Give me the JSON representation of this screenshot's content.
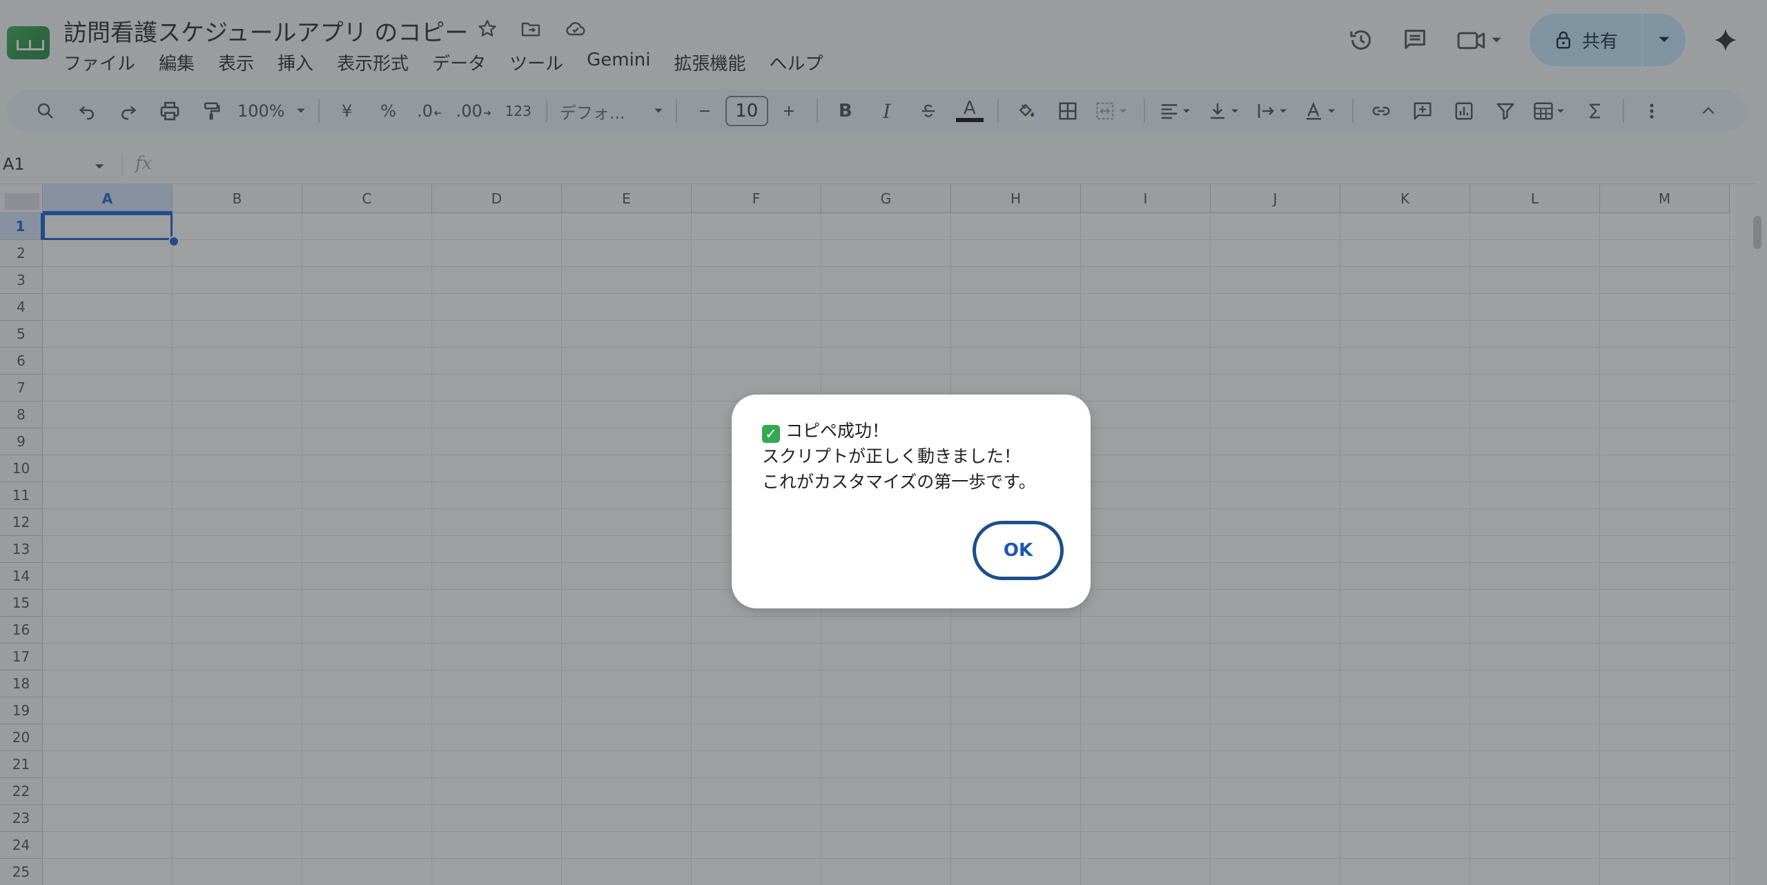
{
  "doc": {
    "title": "訪問看護スケジュールアプリ のコピー"
  },
  "menu": [
    "ファイル",
    "編集",
    "表示",
    "挿入",
    "表示形式",
    "データ",
    "ツール",
    "Gemini",
    "拡張機能",
    "ヘルプ"
  ],
  "share": {
    "label": "共有"
  },
  "toolbar": {
    "zoom": "100%",
    "currency": "¥",
    "percent": "%",
    "dec_decrease": ".0",
    "dec_increase": ".00",
    "number_format": "123",
    "font": "デフォ...",
    "font_size": "10",
    "bold": "B",
    "italic": "I",
    "text_color": "A"
  },
  "formula_bar": {
    "name_box": "A1",
    "fx": "fx"
  },
  "columns": [
    "A",
    "B",
    "C",
    "D",
    "E",
    "F",
    "G",
    "H",
    "I",
    "J",
    "K",
    "L",
    "M"
  ],
  "rows": [
    "1",
    "2",
    "3",
    "4",
    "5",
    "6",
    "7",
    "8",
    "9",
    "10",
    "11",
    "12",
    "13",
    "14",
    "15",
    "16",
    "17",
    "18",
    "19",
    "20",
    "21",
    "22",
    "23",
    "24",
    "25"
  ],
  "selected": {
    "column": "A",
    "row": "1"
  },
  "dialog": {
    "check": "✓",
    "line1": "コピペ成功！",
    "line2": "スクリプトが正しく動きました！",
    "line3": "これがカスタマイズの第一歩です。",
    "ok_label": "OK"
  },
  "colors": {
    "overlay": "#3c4043",
    "accent": "#0b57d0",
    "share_bg": "#c2e7ff",
    "ok_border": "#1c4f8a",
    "check_green": "#34a853"
  },
  "icons": [
    "sheets-logo-icon",
    "star-icon",
    "move-folder-icon",
    "cloud-status-icon",
    "history-icon",
    "comments-icon",
    "meet-icon",
    "lock-icon",
    "gemini-icon",
    "search-icon",
    "undo-icon",
    "redo-icon",
    "print-icon",
    "paint-format-icon",
    "strikethrough-icon",
    "fill-color-icon",
    "borders-icon",
    "merge-cells-icon",
    "align-icon",
    "valign-icon",
    "wrap-icon",
    "rotate-icon",
    "link-icon",
    "comment-add-icon",
    "chart-icon",
    "filter-icon",
    "table-icon",
    "function-icon",
    "more-vert-icon",
    "collapse-icon"
  ]
}
